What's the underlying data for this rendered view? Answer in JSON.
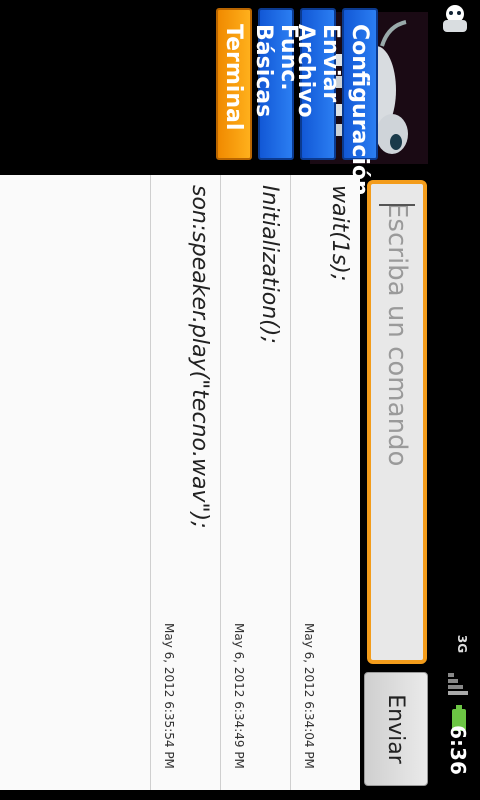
{
  "status_bar": {
    "time": "6:36",
    "network": "3G",
    "icons": [
      "notification-robot-icon",
      "signal-icon",
      "battery-charging-icon"
    ],
    "battery_color": "#6cc644"
  },
  "nav": {
    "terminal": "Terminal",
    "basicas": "Func. Básicas",
    "archivo": "Enviar Archivo",
    "config": "Configuración"
  },
  "command": {
    "placeholder": "Escriba un comando",
    "send": "Enviar"
  },
  "log": [
    {
      "command": "wait(1s);",
      "timestamp": "May 6, 2012 6:34:04 PM"
    },
    {
      "command": "Initialization();",
      "timestamp": "May 6, 2012 6:34:49 PM"
    },
    {
      "command": "son:speaker.play(\"tecno.wav\");",
      "timestamp": "May 6, 2012 6:35:54 PM"
    }
  ],
  "colors": {
    "accent": "#f39c1b",
    "nav_blue": "#1b6fe8",
    "log_bg": "#fafafa"
  }
}
